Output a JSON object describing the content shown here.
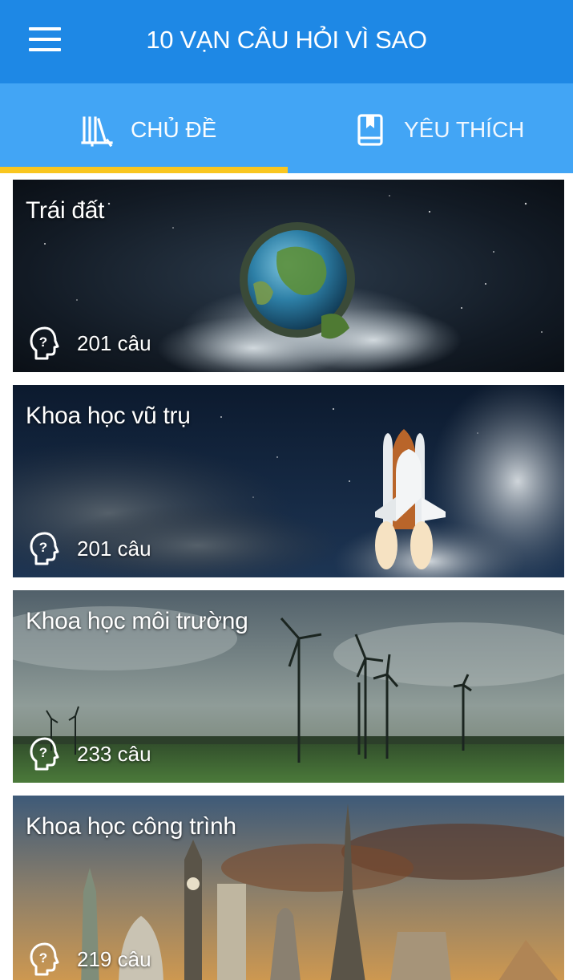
{
  "app": {
    "title": "10 VẠN CÂU HỎI VÌ SAO",
    "primary_color": "#1E88E5",
    "tab_color": "#42A5F5",
    "accent_color": "#F9C61F"
  },
  "header": {
    "menu_icon": "hamburger-menu-icon"
  },
  "tabs": [
    {
      "label": "CHỦ ĐỀ",
      "icon": "library-books-icon",
      "selected": true
    },
    {
      "label": "YÊU THÍCH",
      "icon": "bookmark-book-icon",
      "selected": false
    }
  ],
  "topics": [
    {
      "title": "Trái đất",
      "count": "201 câu",
      "icon": "question-head-icon",
      "image": "earth-in-space"
    },
    {
      "title": "Khoa học vũ trụ",
      "count": "201 câu",
      "icon": "question-head-icon",
      "image": "space-shuttle-launch"
    },
    {
      "title": "Khoa học môi trường",
      "count": "233 câu",
      "icon": "question-head-icon",
      "image": "wind-turbines-field"
    },
    {
      "title": "Khoa học công trình",
      "count": "219 câu",
      "icon": "question-head-icon",
      "image": "world-landmarks"
    }
  ]
}
